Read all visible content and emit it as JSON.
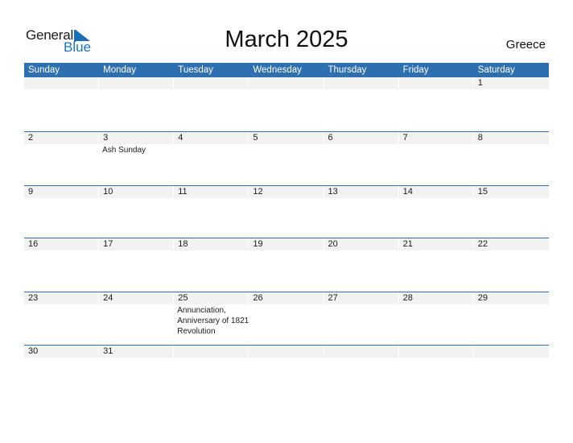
{
  "logo": {
    "general": "General",
    "blue": "Blue"
  },
  "title": "March 2025",
  "country": "Greece",
  "colors": {
    "header_bg": "#2e6fb0",
    "date_bar": "#f2f2f2",
    "accent": "#1a6fb8"
  },
  "weekdays": [
    "Sunday",
    "Monday",
    "Tuesday",
    "Wednesday",
    "Thursday",
    "Friday",
    "Saturday"
  ],
  "weeks": [
    {
      "days": [
        "",
        "",
        "",
        "",
        "",
        "",
        "1"
      ],
      "notes": [
        "",
        "",
        "",
        "",
        "",
        "",
        ""
      ]
    },
    {
      "days": [
        "2",
        "3",
        "4",
        "5",
        "6",
        "7",
        "8"
      ],
      "notes": [
        "",
        "Ash Sunday",
        "",
        "",
        "",
        "",
        ""
      ]
    },
    {
      "days": [
        "9",
        "10",
        "11",
        "12",
        "13",
        "14",
        "15"
      ],
      "notes": [
        "",
        "",
        "",
        "",
        "",
        "",
        ""
      ]
    },
    {
      "days": [
        "16",
        "17",
        "18",
        "19",
        "20",
        "21",
        "22"
      ],
      "notes": [
        "",
        "",
        "",
        "",
        "",
        "",
        ""
      ]
    },
    {
      "days": [
        "23",
        "24",
        "25",
        "26",
        "27",
        "28",
        "29"
      ],
      "notes": [
        "",
        "",
        "Annunciation, Anniversary of 1821 Revolution",
        "",
        "",
        "",
        ""
      ]
    },
    {
      "days": [
        "30",
        "31",
        "",
        "",
        "",
        "",
        ""
      ],
      "notes": [
        "",
        "",
        "",
        "",
        "",
        "",
        ""
      ]
    }
  ]
}
